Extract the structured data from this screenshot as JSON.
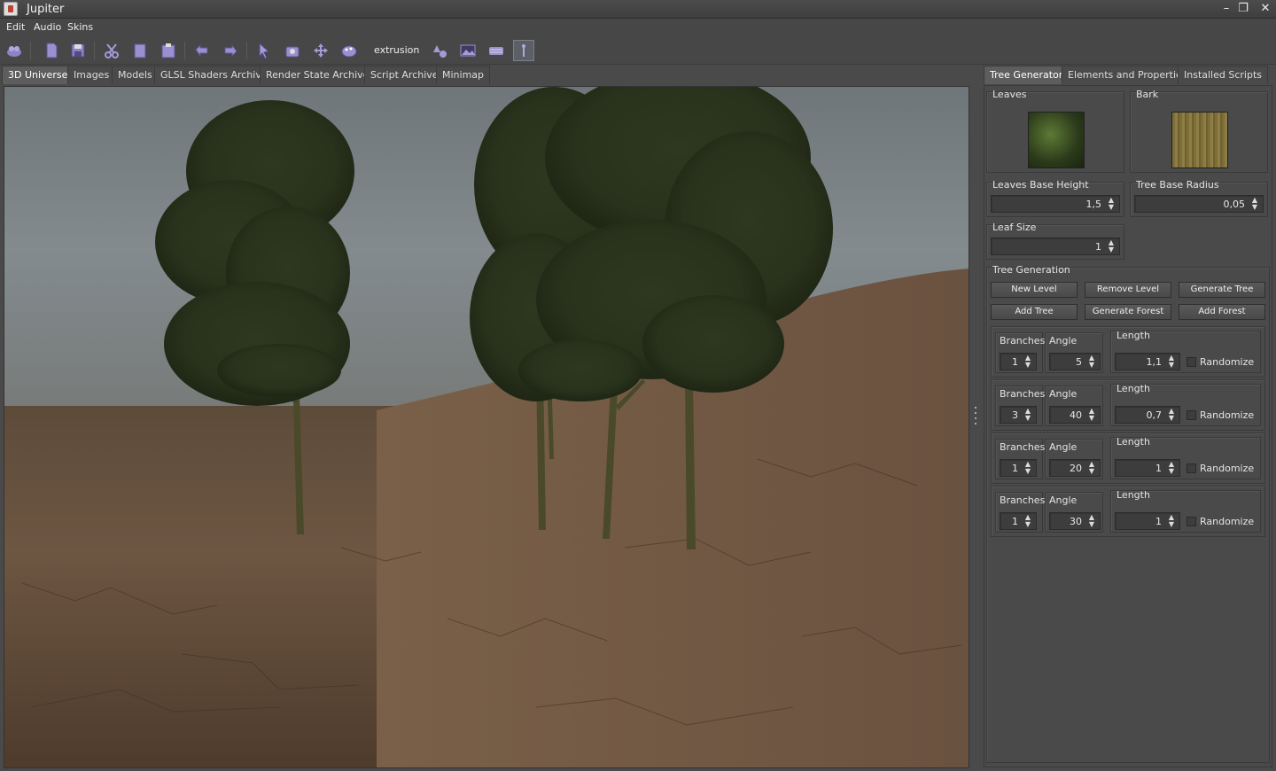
{
  "window": {
    "title": "Jupiter",
    "minimize": "–",
    "restore": "❐",
    "close": "✕"
  },
  "menu": [
    "Edit",
    "Audio",
    "Skins"
  ],
  "toolbar": {
    "extrusion_label": "extrusion"
  },
  "left_tabs": [
    "3D Universe",
    "Images",
    "Models",
    "GLSL Shaders Archive",
    "Render State Archive",
    "Script Archive",
    "Minimap"
  ],
  "right_tabs": [
    "Tree Generator",
    "Elements and Properties",
    "Installed Scripts"
  ],
  "tree_generator": {
    "leaves_label": "Leaves",
    "bark_label": "Bark",
    "leaves_base_height_label": "Leaves Base Height",
    "leaves_base_height": "1,5",
    "tree_base_radius_label": "Tree Base Radius",
    "tree_base_radius": "0,05",
    "leaf_size_label": "Leaf Size",
    "leaf_size": "1",
    "generation_label": "Tree Generation",
    "buttons": [
      "New Level",
      "Remove Level",
      "Generate Tree",
      "Add Tree",
      "Generate Forest",
      "Add Forest"
    ],
    "levels": [
      {
        "branches_label": "Branches",
        "branches": "1",
        "angle_label": "Angle",
        "angle": "5",
        "length_label": "Length",
        "length": "1,1",
        "randomize_label": "Randomize"
      },
      {
        "branches_label": "Branches",
        "branches": "3",
        "angle_label": "Angle",
        "angle": "40",
        "length_label": "Length",
        "length": "0,7",
        "randomize_label": "Randomize"
      },
      {
        "branches_label": "Branches",
        "branches": "1",
        "angle_label": "Angle",
        "angle": "20",
        "length_label": "Length",
        "length": "1",
        "randomize_label": "Randomize"
      },
      {
        "branches_label": "Branches",
        "branches": "1",
        "angle_label": "Angle",
        "angle": "30",
        "length_label": "Length",
        "length": "1",
        "randomize_label": "Randomize"
      }
    ]
  },
  "colors": {
    "accent": "#7a6fb0",
    "sky": "#7c858a",
    "ground": "#6b5440",
    "foliage": "#2f3a1e"
  }
}
